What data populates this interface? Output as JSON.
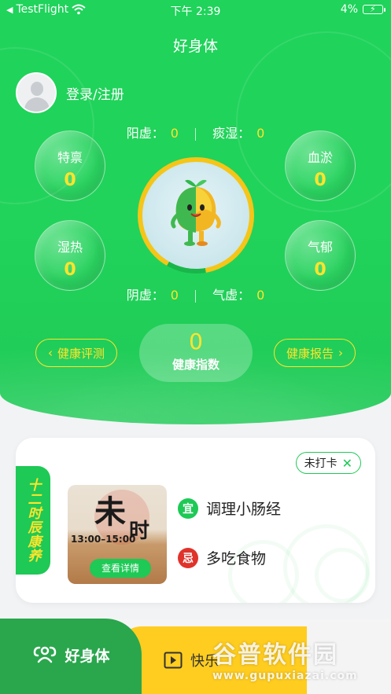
{
  "status_bar": {
    "back_app": "TestFlight",
    "time": "下午 2:39",
    "battery": "4%"
  },
  "nav": {
    "title": "好身体"
  },
  "user": {
    "login_label": "登录/注册"
  },
  "top_stats": [
    {
      "label": "阳虚：",
      "value": "0"
    },
    {
      "label": "痰湿：",
      "value": "0"
    }
  ],
  "bottom_stats": [
    {
      "label": "阴虚：",
      "value": "0"
    },
    {
      "label": "气虚：",
      "value": "0"
    }
  ],
  "bubbles": {
    "tebing": {
      "name": "特禀",
      "value": "0"
    },
    "xueyu": {
      "name": "血淤",
      "value": "0"
    },
    "shire": {
      "name": "湿热",
      "value": "0"
    },
    "qiyu": {
      "name": "气郁",
      "value": "0"
    }
  },
  "actions": {
    "left": "健康评测",
    "right": "健康报告"
  },
  "health_index": {
    "value": "0",
    "label": "健康指数"
  },
  "card": {
    "side_title": "十二时辰康养",
    "checkin": "未打卡",
    "time_big1": "未",
    "time_big2": "时",
    "time_range": "13:00–15:00",
    "detail_button": "查看详情",
    "suitable": {
      "icon": "宜",
      "text": "调理小肠经",
      "color": "#1ec956"
    },
    "avoid": {
      "icon": "忌",
      "text": "多吃食物",
      "color": "#e0332b"
    }
  },
  "tabs": {
    "home": "好身体",
    "second": "快乐"
  },
  "watermark": {
    "line1": "谷普软件园",
    "line2": "www.gupuxiazai.com"
  }
}
